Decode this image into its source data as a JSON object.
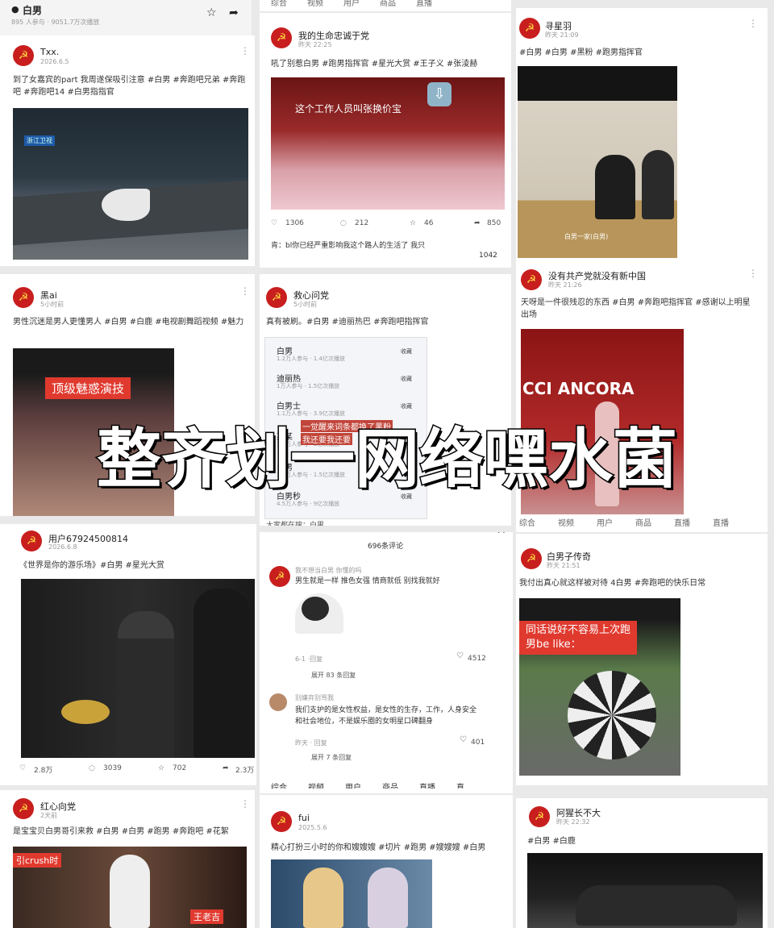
{
  "top_header": {
    "title": "白男",
    "sub": "895 人参与 · 9051.7万次播放"
  },
  "overlay_text": "整齐划一网络嘿水菌",
  "cards": {
    "c1": {
      "user": "Txx.",
      "time": "2026.6.5",
      "text": "到了女嘉宾的part 我周遂保吸引注意 #白男 #奔跑吧兄弟 #奔跑吧 #奔跑吧14 #白男指指官",
      "media_tag": "浙江卫视"
    },
    "c2": {
      "user": "我的生命忠诚于党",
      "time": "昨天 22:25",
      "text": "吼了别惹白男 #跑男指挥官 #星光大赏 #王子义 #张淩赫",
      "caption": "这个工作人员叫张换价宝",
      "likes": "1306",
      "comments": "212",
      "stars": "46",
      "shares": "850",
      "comment_text": "肯：bl你已经严重影响我这个路人的生活了 我只",
      "comment_likes": "1042"
    },
    "c3": {
      "user": "寻星羽",
      "time": "昨天 21:09",
      "text": "#白男 #白男 #黑粉 #跑男指挥官",
      "media_text": "白男一家(白男)"
    },
    "c4": {
      "user": "黑ai",
      "time": "5小时前",
      "text": "男性沉迷是男人更懂男人 #白男 #白鹿 #电视剧舞蹈视频 #魅力",
      "caption": "顶级魅惑演技"
    },
    "c5": {
      "user": "救心问党",
      "time": "5小时前",
      "text": "真有被刷。#白男 #迪丽热巴 #奔跑吧指挥官",
      "search_rows": [
        {
          "name": "白男",
          "sub": "1.2万人参与 · 1.4亿次播放",
          "btn": "收藏"
        },
        {
          "name": "迪丽热",
          "sub": "1万人参与 · 1.5亿次播放",
          "btn": "收藏"
        },
        {
          "name": "白男士",
          "sub": "1.1万人参与 · 3.9亿次播放",
          "btn": "收藏"
        },
        {
          "name": "某某",
          "sub": "1.5万人参与 · 2亿次播放",
          "btn": "收藏"
        },
        {
          "name": "白男",
          "sub": "1.4万人参与 · 1.5亿次播放",
          "btn": "收藏"
        },
        {
          "name": "白男秒",
          "sub": "4.5万人参与 · 9亿次播放",
          "btn": "收藏"
        }
      ],
      "search_note": "一觉醒来词条都换了黑粉",
      "search_note2": "我还要我还要",
      "footer": "大家都在搜：白男"
    },
    "c6": {
      "user": "没有共产党就没有新中国",
      "time": "昨天 21:26",
      "text": "天呀是一件很残忍的东西 #白男 #奔跑吧指挥官 #感谢以上明星出场",
      "media_text": "CCI ANCORA"
    },
    "c7": {
      "user": "用户67924500814",
      "time": "2026.6.8",
      "text": "《世界是你的游乐场》#白男 #星光大赏",
      "likes": "2.8万",
      "comments": "3039",
      "stars": "702",
      "shares": "2.3万"
    },
    "c8": {
      "header": "696条评论",
      "c1_user": "我不想当白男 你懂的吗",
      "c1_text": "男生就是一样 推色女强 情商就低 别找我就好",
      "c1_time": "6-1 ·回复",
      "c1_likes": "4512",
      "c1_more": "展开 83 条回复",
      "c2_user": "别嫌弃别骂我",
      "c2_text": "我们支护的是女性权益，是女性的生存，工作，人身安全和社会地位，不是娱乐圈的女明星口碑翻身",
      "c2_time": "昨天 · 回复",
      "c2_likes": "401",
      "c2_more": "展开 7 条回复",
      "tabs": [
        "综合",
        "视频",
        "用户",
        "商品",
        "直播",
        "直…"
      ]
    },
    "c9": {
      "user": "白男子传奇",
      "time": "昨天 21:51",
      "text": "我付出真心就这样被对待 4白男 #奔跑吧的快乐日常",
      "caption": "同话说好不容易上次跑男be like："
    },
    "c10": {
      "user": "红心向党",
      "time": "2天前",
      "text": "是宝宝贝白男哥引来救 #白男 #白男 #跑男 #奔跑吧 #花絮",
      "caption": "引crush时",
      "caption2": "王老吉"
    },
    "c11": {
      "user": "fui",
      "time": "2025.5.6",
      "text": "精心打扮三小时的你和嫂嫂嫂 #切片 #跑男 #嫂嫂嫂 #白男"
    },
    "c12": {
      "user": "阿猩长不大",
      "time": "昨天 22:32",
      "text": "#白男 #白鹿"
    }
  },
  "strip_tabs": {
    "top_mid": [
      "综合",
      "视频",
      "用户",
      "商品",
      "直播"
    ],
    "row2_right": [
      "综合",
      "视频",
      "用户",
      "商品",
      "直播",
      "直播"
    ],
    "row3_mid": [
      "综合",
      "视频",
      "用户",
      "商品",
      "直播",
      "直播"
    ]
  },
  "colors": {
    "avatar_red": "#c81e1e",
    "caption_red": "#e03a2f"
  }
}
